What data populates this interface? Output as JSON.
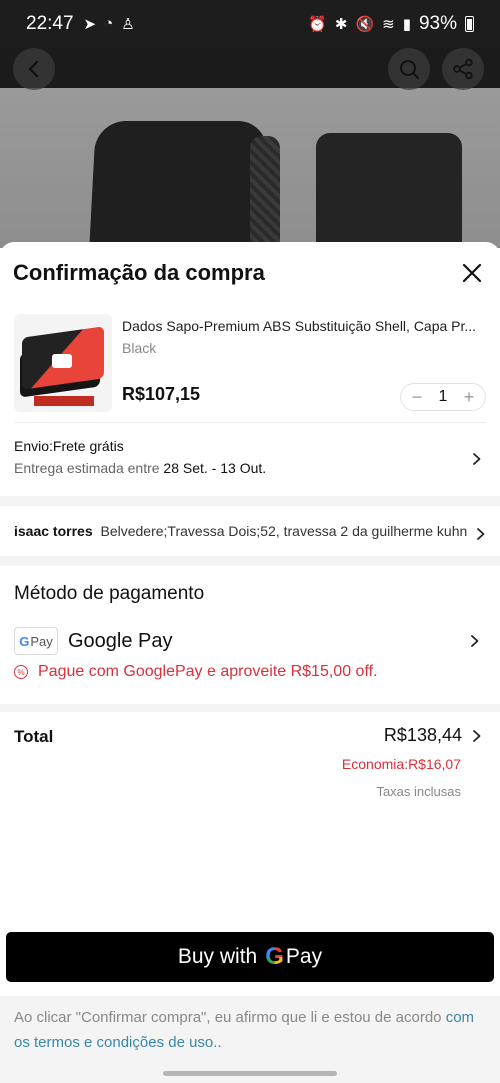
{
  "status_bar": {
    "time": "22:47",
    "battery": "93%"
  },
  "header": {
    "title": "Confirmação da compra"
  },
  "product": {
    "name": "Dados Sapo-Premium ABS Substituição Shell, Capa Pr...",
    "variant": "Black",
    "price": "R$107,15",
    "quantity": "1"
  },
  "shipping": {
    "title": "Envio:Frete grátis",
    "estimate_prefix": "Entrega estimada entre ",
    "estimate_dates": "28 Set. - 13 Out."
  },
  "address": {
    "name": "isaac torres",
    "line": "Belvedere;Travessa Dois;52, travessa 2 da guilherme kuhn"
  },
  "payment": {
    "title": "Método de pagamento",
    "badge": "Pay",
    "badge_g": "G",
    "method": "Google Pay",
    "promo": "Pague com GooglePay e aproveite R$15,00 off."
  },
  "totals": {
    "label": "Total",
    "value": "R$138,44",
    "savings": "Economia:R$16,07",
    "tax_note": "Taxas inclusas"
  },
  "buy_button": {
    "prefix": "Buy with",
    "g": "G",
    "suffix": "Pay"
  },
  "legal": {
    "text": "Ao clicar \"Confirmar compra\", eu afirmo que li e estou de acordo ",
    "terms": "com os termos e condições de uso.."
  },
  "colors": {
    "accent_red": "#d9313b",
    "link_blue": "#3a86a8",
    "button_black": "#000000"
  },
  "icons": [
    "back-arrow-icon",
    "search-icon",
    "share-icon",
    "close-icon",
    "chevron-right-icon",
    "discount-icon",
    "google-pay-icon"
  ]
}
